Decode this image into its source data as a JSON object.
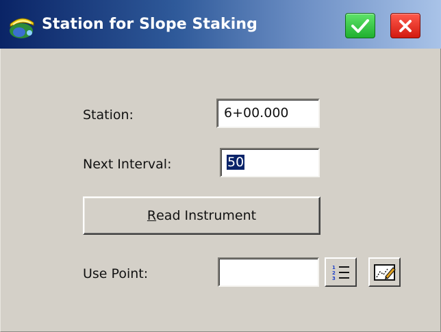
{
  "window": {
    "title": "Station for Slope Staking",
    "app_icon": "surveyor-helmet-icon",
    "ok_icon": "checkmark-icon",
    "close_icon": "close-x-icon",
    "colors": {
      "titlebar_start": "#0a2466",
      "titlebar_end": "#a9c3e8",
      "ok_button": "#1fb02f",
      "close_button": "#d21a10",
      "background": "#d4d0c8",
      "selection": "#0a246a"
    }
  },
  "form": {
    "station_label": "Station:",
    "station_value": "6+00.000",
    "interval_label": "Next Interval:",
    "interval_value": "50",
    "read_button": {
      "mnemonic": "R",
      "rest": "ead Instrument"
    },
    "use_point_label": "Use Point:",
    "use_point_value": "",
    "list_icon": "numbered-list-icon",
    "map_icon": "map-pick-icon"
  }
}
